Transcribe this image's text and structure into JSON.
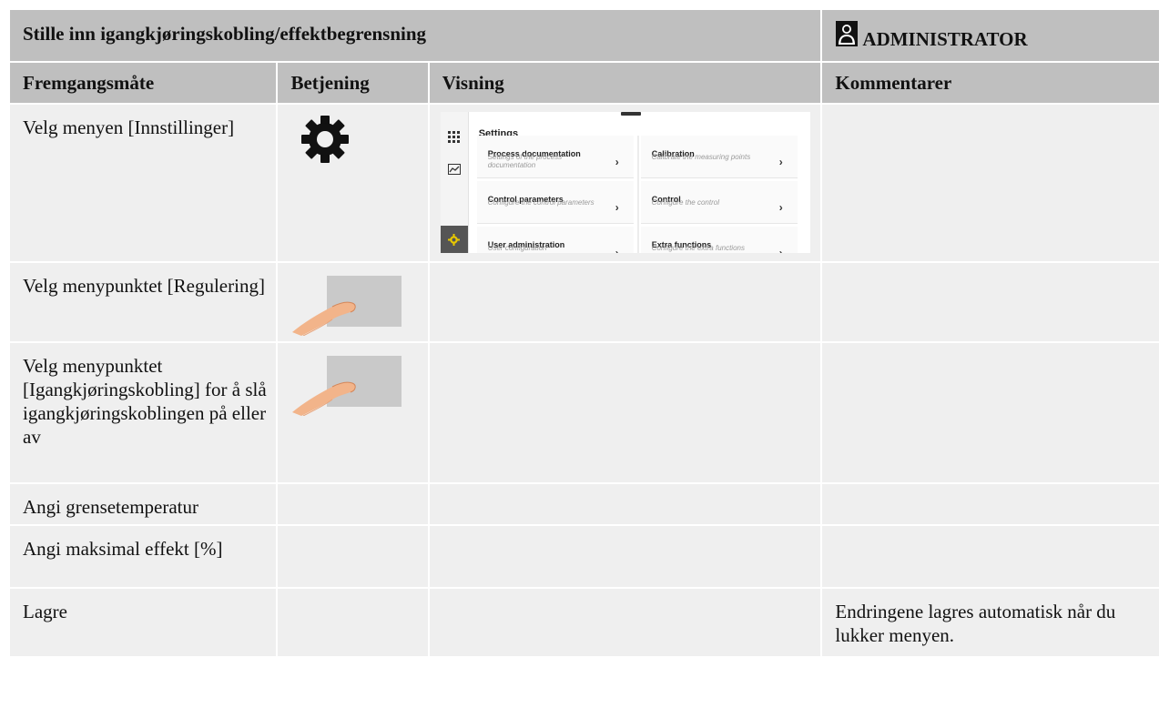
{
  "header": {
    "title": "Stille inn igangkjøringskobling/effektbegrensning",
    "role": "ADMINISTRATOR"
  },
  "columns": [
    "Fremgangsmåte",
    "Betjening",
    "Visning",
    "Kommentarer"
  ],
  "rows": [
    {
      "step": "Velg menyen [Innstillinger]",
      "control_icon": "gear-icon",
      "comment": ""
    },
    {
      "step": "Velg menypunktet [Regulering]",
      "control_icon": "finger-tap-icon",
      "comment": ""
    },
    {
      "step": "Velg menypunktet [Igangkjøringskobling] for å slå igangkjøringskoblingen på eller av",
      "control_icon": "finger-tap-icon",
      "comment": ""
    },
    {
      "step": "Angi grensetemperatur",
      "control_icon": "",
      "comment": ""
    },
    {
      "step": "Angi maksimal effekt [%]",
      "control_icon": "",
      "comment": ""
    },
    {
      "step": "Lagre",
      "control_icon": "",
      "comment": "Endringene lagres automatisk når du lukker menyen."
    }
  ],
  "settings_screen": {
    "title": "Settings",
    "tiles": [
      {
        "title": "Process documentation",
        "subtitle": "Settings of the process documentation"
      },
      {
        "title": "Calibration",
        "subtitle": "Calibrate the measuring points"
      },
      {
        "title": "Control parameters",
        "subtitle": "Configure the control parameters"
      },
      {
        "title": "Control",
        "subtitle": "Configure the control"
      },
      {
        "title": "User administration",
        "subtitle": "User configuration"
      },
      {
        "title": "Extra functions",
        "subtitle": "Configure the extra functions"
      }
    ],
    "sidebar_icons": [
      "apps-grid-icon",
      "chart-icon",
      "settings-gear-icon"
    ],
    "accent_color": "#e8c800"
  },
  "colors": {
    "header_bg": "#bfbfbf",
    "cell_bg": "#efefef"
  }
}
